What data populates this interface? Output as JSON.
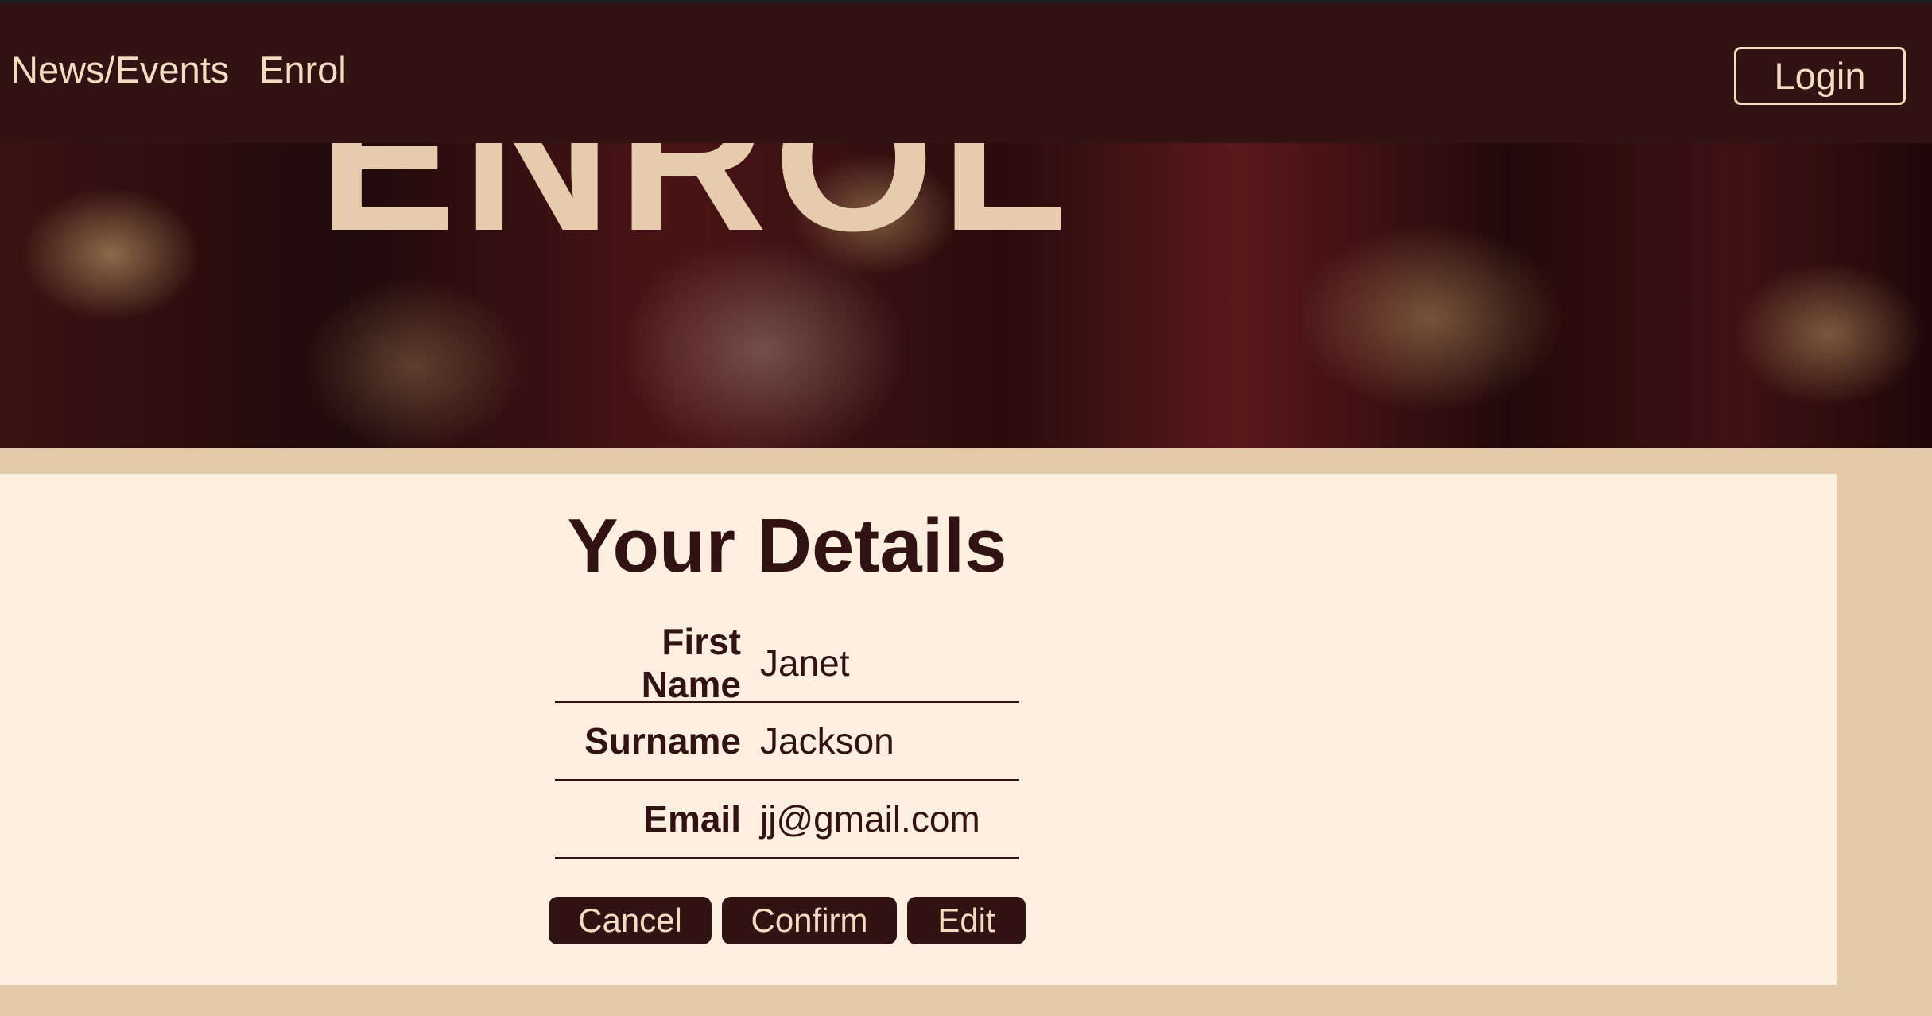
{
  "nav": {
    "links": [
      "News/Events",
      "Enrol"
    ],
    "login_label": "Login"
  },
  "hero": {
    "heading": "ENROL"
  },
  "details": {
    "title": "Your Details",
    "fields": [
      {
        "label": "First Name",
        "value": "Janet"
      },
      {
        "label": "Surname",
        "value": "Jackson"
      },
      {
        "label": "Email",
        "value": "jj@gmail.com"
      }
    ]
  },
  "actions": {
    "cancel_label": "Cancel",
    "confirm_label": "Confirm",
    "edit_label": "Edit"
  },
  "colors": {
    "brand_dark": "#311313",
    "cream": "#fcefe0",
    "tan": "#e3caa9",
    "accent_text": "#f2dcc2"
  }
}
